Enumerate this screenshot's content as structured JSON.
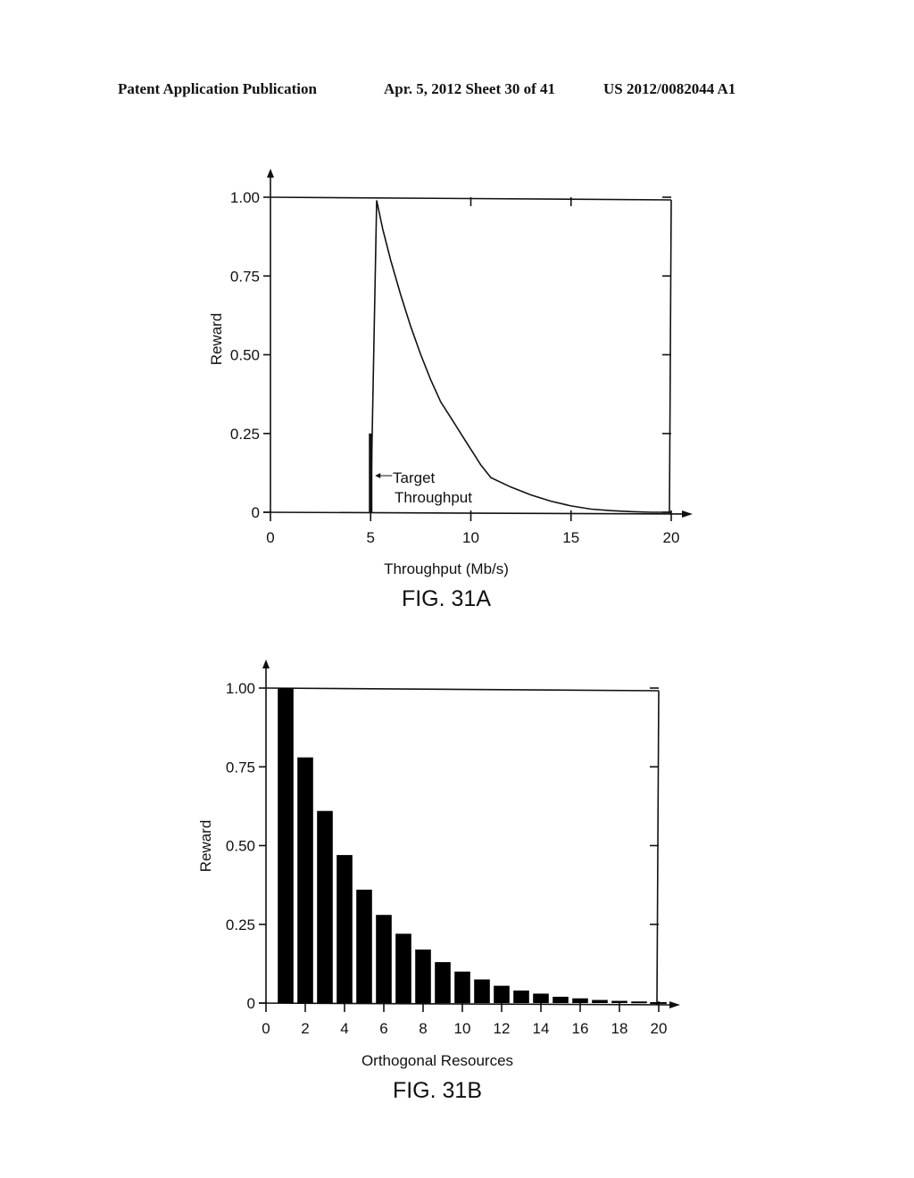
{
  "header": {
    "publication": "Patent Application Publication",
    "date_sheet": "Apr. 5, 2012   Sheet 30 of 41",
    "patent_number": "US 2012/0082044 A1"
  },
  "chart_data": [
    {
      "id": "fig31a",
      "type": "line",
      "title": "FIG. 31A",
      "xlabel": "Throughput (Mb/s)",
      "ylabel": "Reward",
      "xlim": [
        0,
        20
      ],
      "ylim": [
        0,
        1.0
      ],
      "xticks": [
        "0",
        "5",
        "10",
        "15",
        "20"
      ],
      "yticks": [
        "0",
        "0.25",
        "0.50",
        "0.75",
        "1.00"
      ],
      "grid": false,
      "annotation": {
        "text_line1": "Target",
        "text_line2": "Throughput",
        "x": 5
      },
      "target_marker": {
        "x": 5,
        "y_top": 0.25
      },
      "series": [
        {
          "name": "Reward",
          "x": [
            5.0,
            5.3,
            5.6,
            6.0,
            6.5,
            7.0,
            7.5,
            8.0,
            8.5,
            9.0,
            9.5,
            10.0,
            10.5,
            11.0,
            12.0,
            13.0,
            14.0,
            15.0,
            16.0,
            17.0,
            18.0,
            19.0,
            20.0
          ],
          "y": [
            0.0,
            0.99,
            0.9,
            0.8,
            0.69,
            0.59,
            0.5,
            0.42,
            0.35,
            0.3,
            0.25,
            0.2,
            0.15,
            0.11,
            0.08,
            0.055,
            0.035,
            0.02,
            0.01,
            0.005,
            0.002,
            0.0,
            0.0
          ]
        }
      ]
    },
    {
      "id": "fig31b",
      "type": "bar",
      "title": "FIG. 31B",
      "xlabel": "Orthogonal Resources",
      "ylabel": "Reward",
      "xlim": [
        0,
        20
      ],
      "ylim": [
        0,
        1.0
      ],
      "xticks": [
        "0",
        "2",
        "4",
        "6",
        "8",
        "10",
        "12",
        "14",
        "16",
        "18",
        "20"
      ],
      "yticks": [
        "0",
        "0.25",
        "0.50",
        "0.75",
        "1.00"
      ],
      "grid": false,
      "categories": [
        1,
        2,
        3,
        4,
        5,
        6,
        7,
        8,
        9,
        10,
        11,
        12,
        13,
        14,
        15,
        16,
        17,
        18,
        19,
        20
      ],
      "values": [
        1.0,
        0.78,
        0.61,
        0.47,
        0.36,
        0.28,
        0.22,
        0.17,
        0.13,
        0.1,
        0.075,
        0.055,
        0.04,
        0.03,
        0.02,
        0.015,
        0.01,
        0.007,
        0.005,
        0.003
      ]
    }
  ]
}
